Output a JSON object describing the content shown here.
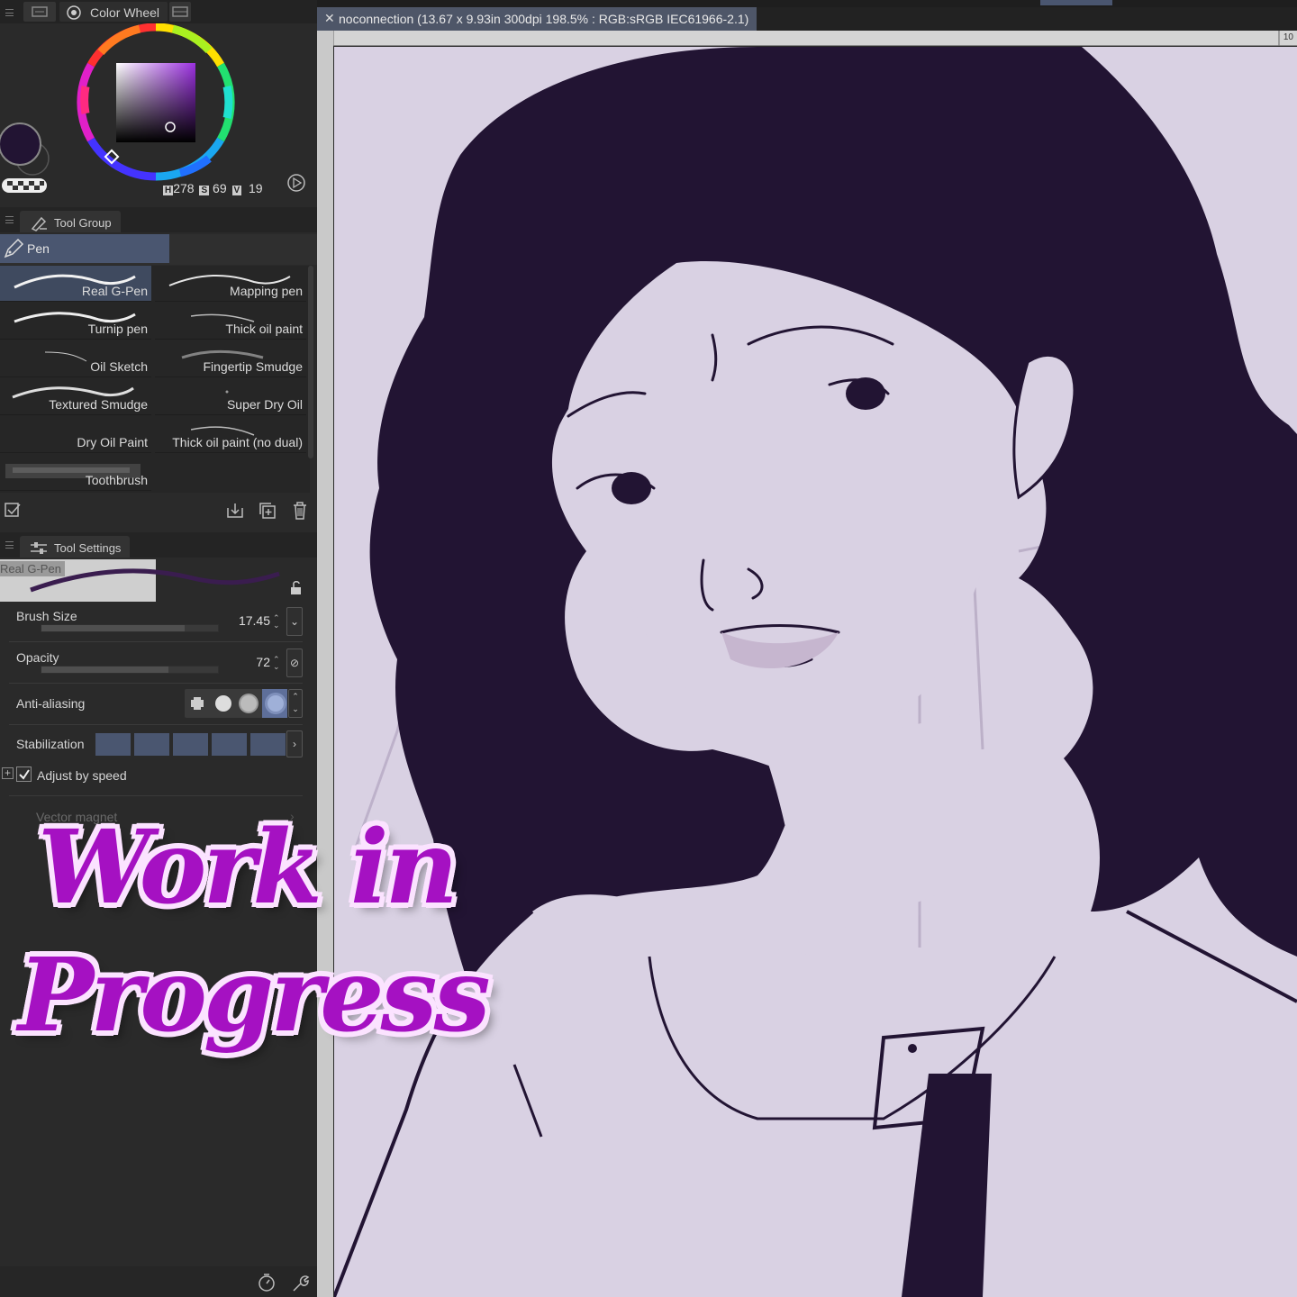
{
  "color_panel": {
    "title": "Color Wheel",
    "h_label": "H",
    "h_value": "278",
    "s_label": "S",
    "s_value": "69",
    "v_label": "V",
    "v_value": "19",
    "main_color": "#221433",
    "sub_color": "#2a2a2a"
  },
  "tool_group": {
    "title": "Tool Group",
    "active_tab": "Pen",
    "brushes": [
      {
        "label": "Real G-Pen",
        "selected": true
      },
      {
        "label": "Mapping pen",
        "selected": false
      },
      {
        "label": "Turnip pen",
        "selected": false
      },
      {
        "label": "Thick oil paint",
        "selected": false
      },
      {
        "label": "Oil Sketch",
        "selected": false
      },
      {
        "label": "Fingertip Smudge",
        "selected": false
      },
      {
        "label": "Textured Smudge",
        "selected": false
      },
      {
        "label": "Super Dry Oil",
        "selected": false
      },
      {
        "label": "Dry Oil Paint",
        "selected": false
      },
      {
        "label": "Thick oil paint (no dual)",
        "selected": false
      },
      {
        "label": "Toothbrush",
        "selected": false
      }
    ]
  },
  "tool_settings": {
    "title": "Tool Settings",
    "tool_name": "Real G-Pen",
    "brush_size_label": "Brush Size",
    "brush_size_value": "17.45",
    "brush_size_fraction": 0.81,
    "opacity_label": "Opacity",
    "opacity_value": "72",
    "opacity_fraction": 0.72,
    "antialiasing_label": "Anti-aliasing",
    "antialiasing_selected": 3,
    "stabilization_label": "Stabilization",
    "adjust_by_speed_label": "Adjust by speed",
    "adjust_by_speed_checked": true,
    "vector_magnet_label": "Vector magnet"
  },
  "document": {
    "tab_title": "noconnection (13.67 x 9.93in 300dpi 198.5% : RGB:sRGB IEC61966-2.1)",
    "ruler_label": "10"
  },
  "overlay": {
    "line1": "Work in",
    "line2": "Progress"
  },
  "colors": {
    "ink": "#221433",
    "canvas_bg": "#d9d1e3",
    "sketch": "#b3a7c0",
    "accent_selection": "#4a5670",
    "overlay_text": "#a511c2"
  }
}
